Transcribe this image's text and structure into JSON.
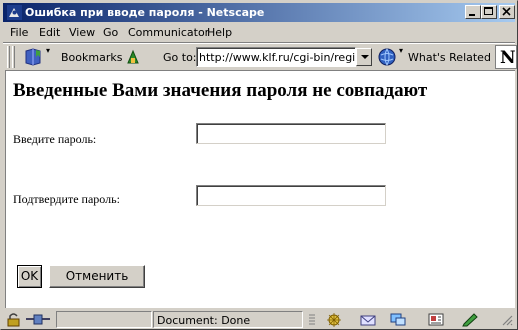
{
  "window": {
    "title": "Ошибка при вводе пароля - Netscape",
    "controls": {
      "minimize": "_",
      "maximize": "□",
      "close": "×"
    }
  },
  "menu": [
    "File",
    "Edit",
    "View",
    "Go",
    "Communicator",
    "Help"
  ],
  "toolbar": {
    "bookmarks_label": "Bookmarks",
    "goto_label": "Go to:",
    "url": "http://www.klf.ru/cgi-bin/registra",
    "whats_related_label": "What's Related",
    "logo_letter": "N"
  },
  "page": {
    "heading": "Введенные Вами значения пароля не совпадают",
    "password_label": "Введите пароль:",
    "password_value": "",
    "confirm_label": "Подтвердите пароль:",
    "confirm_value": "",
    "ok_label": "OK",
    "cancel_label": "Отменить"
  },
  "status": {
    "text": "Document: Done"
  },
  "colors": {
    "titlebar_start": "#0a246a",
    "titlebar_end": "#a6caf0",
    "chrome": "#d4d0c8"
  }
}
